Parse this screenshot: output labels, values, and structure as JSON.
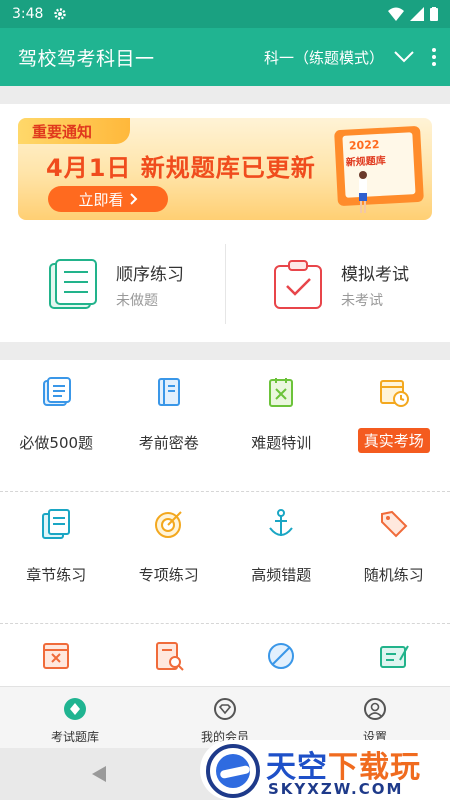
{
  "status_bar": {
    "time": "3:48"
  },
  "app_bar": {
    "title": "驾校驾考科目一",
    "mode": "科一（练题模式）"
  },
  "banner": {
    "tag": "重要通知",
    "headline": "4月1日 新规题库已更新",
    "button": "立即看",
    "board_year": "2022",
    "board_label": "新规题库"
  },
  "practice": [
    {
      "title": "顺序练习",
      "status": "未做题"
    },
    {
      "title": "模拟考试",
      "status": "未考试"
    }
  ],
  "grid": {
    "row1": [
      "必做500题",
      "考前密卷",
      "难题特训",
      "真实考场"
    ],
    "row2": [
      "章节练习",
      "专项练习",
      "高频错题",
      "随机练习"
    ]
  },
  "bottom_nav": {
    "items": [
      "考试题库",
      "我的会员",
      "设置"
    ]
  },
  "watermark": {
    "text_blue": "天空",
    "text_orange": "下载玩",
    "sub": "SKYXZW.COM"
  },
  "colors": {
    "primary": "#20b491",
    "status": "#1aa181",
    "accent": "#f45b1f"
  }
}
